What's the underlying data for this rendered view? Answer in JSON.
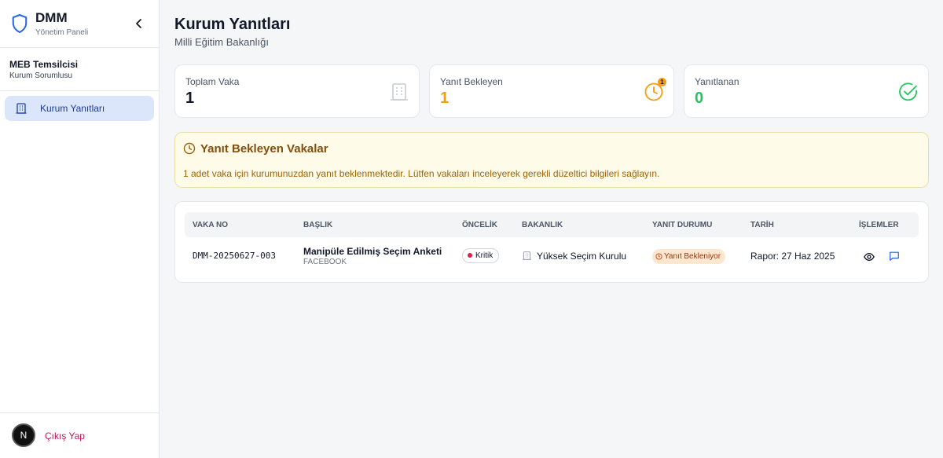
{
  "app": {
    "title": "DMM",
    "subtitle": "Yönetim Paneli"
  },
  "user": {
    "name": "MEB Temsilcisi",
    "role": "Kurum Sorumlusu"
  },
  "sidebar": {
    "items": [
      {
        "label": "Kurum Yanıtları",
        "icon": "building-icon",
        "active": true
      }
    ]
  },
  "footer": {
    "avatar_letter": "N",
    "logout_label": "Çıkış Yap"
  },
  "page": {
    "title": "Kurum Yanıtları",
    "subtitle": "Milli Eğitim Bakanlığı"
  },
  "stats": [
    {
      "label": "Toplam Vaka",
      "value": "1",
      "color": "#111827",
      "icon": "building-icon"
    },
    {
      "label": "Yanıt Bekleyen",
      "value": "1",
      "color": "#f59e0b",
      "icon": "clock-icon",
      "badge": "1"
    },
    {
      "label": "Yanıtlanan",
      "value": "0",
      "color": "#22c55e",
      "icon": "check-circle-icon"
    }
  ],
  "alert": {
    "title": "Yanıt Bekleyen Vakalar",
    "text": "1 adet vaka için kurumunuzdan yanıt beklenmektedir. Lütfen vakaları inceleyerek gerekli düzeltici bilgileri sağlayın."
  },
  "table": {
    "columns": [
      "VAKA NO",
      "BAŞLIK",
      "ÖNCELİK",
      "BAKANLIK",
      "YANIT DURUMU",
      "TARİH",
      "İŞLEMLER"
    ],
    "rows": [
      {
        "case_no": "DMM-20250627-003",
        "title": "Manipüle Edilmiş Seçim Anketi",
        "source": "FACEBOOK",
        "priority": "Kritik",
        "ministry": "Yüksek Seçim Kurulu",
        "status": "Yanıt Bekleniyor",
        "date": "Rapor: 27 Haz 2025"
      }
    ]
  },
  "colors": {
    "accent": "#2563eb",
    "warning": "#f59e0b",
    "success": "#22c55e",
    "danger": "#e11d48"
  }
}
